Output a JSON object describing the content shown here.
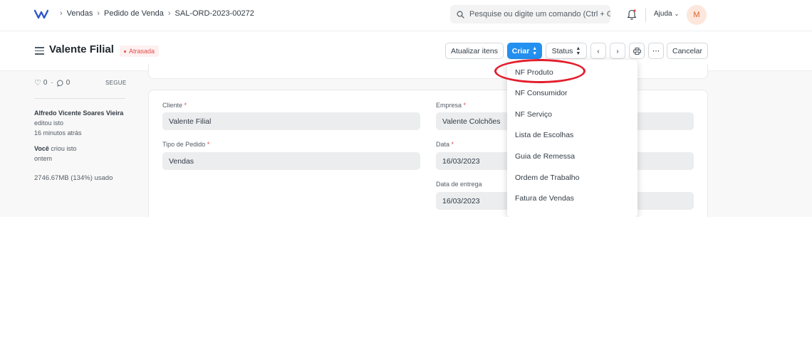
{
  "breadcrumbs": [
    "Vendas",
    "Pedido de Venda",
    "SAL-ORD-2023-00272"
  ],
  "search": {
    "placeholder": "Pesquise ou digite um comando (Ctrl + G"
  },
  "navbar": {
    "help_label": "Ajuda",
    "avatar_initial": "M"
  },
  "header": {
    "title": "Valente Filial",
    "status_badge": "Atrasada",
    "buttons": {
      "update_items": "Atualizar itens",
      "create": "Criar",
      "status": "Status",
      "more": "⋯",
      "cancel": "Cancelar"
    }
  },
  "sidebar": {
    "likes_count": "0",
    "comments_count": "0",
    "follow_label": "SEGUE",
    "activity": [
      {
        "user": "Alfredo Vicente Soares Vieira",
        "action": "editou isto",
        "time": "16 minutos atrás"
      },
      {
        "user": "Você",
        "action": "criou isto",
        "time": "ontem"
      }
    ],
    "storage": "2746.67MB (134%) usado"
  },
  "form": {
    "cliente_label": "Cliente",
    "cliente_value": "Valente Filial",
    "tipo_label": "Tipo de Pedido",
    "tipo_value": "Vendas",
    "empresa_label": "Empresa",
    "empresa_value": "Valente Colchões",
    "data_label": "Data",
    "data_value": "16/03/2023",
    "entrega_label": "Data de entrega",
    "entrega_value": "16/03/2023"
  },
  "dropdown": {
    "items": [
      "NF Produto",
      "NF Consumidor",
      "NF Serviço",
      "Lista de Escolhas",
      "Guia de Remessa",
      "Ordem de Trabalho",
      "Fatura de Vendas"
    ]
  },
  "colors": {
    "primary": "#2490ef",
    "danger": "#e24c4c",
    "annotation_ring": "#e31e2d"
  }
}
